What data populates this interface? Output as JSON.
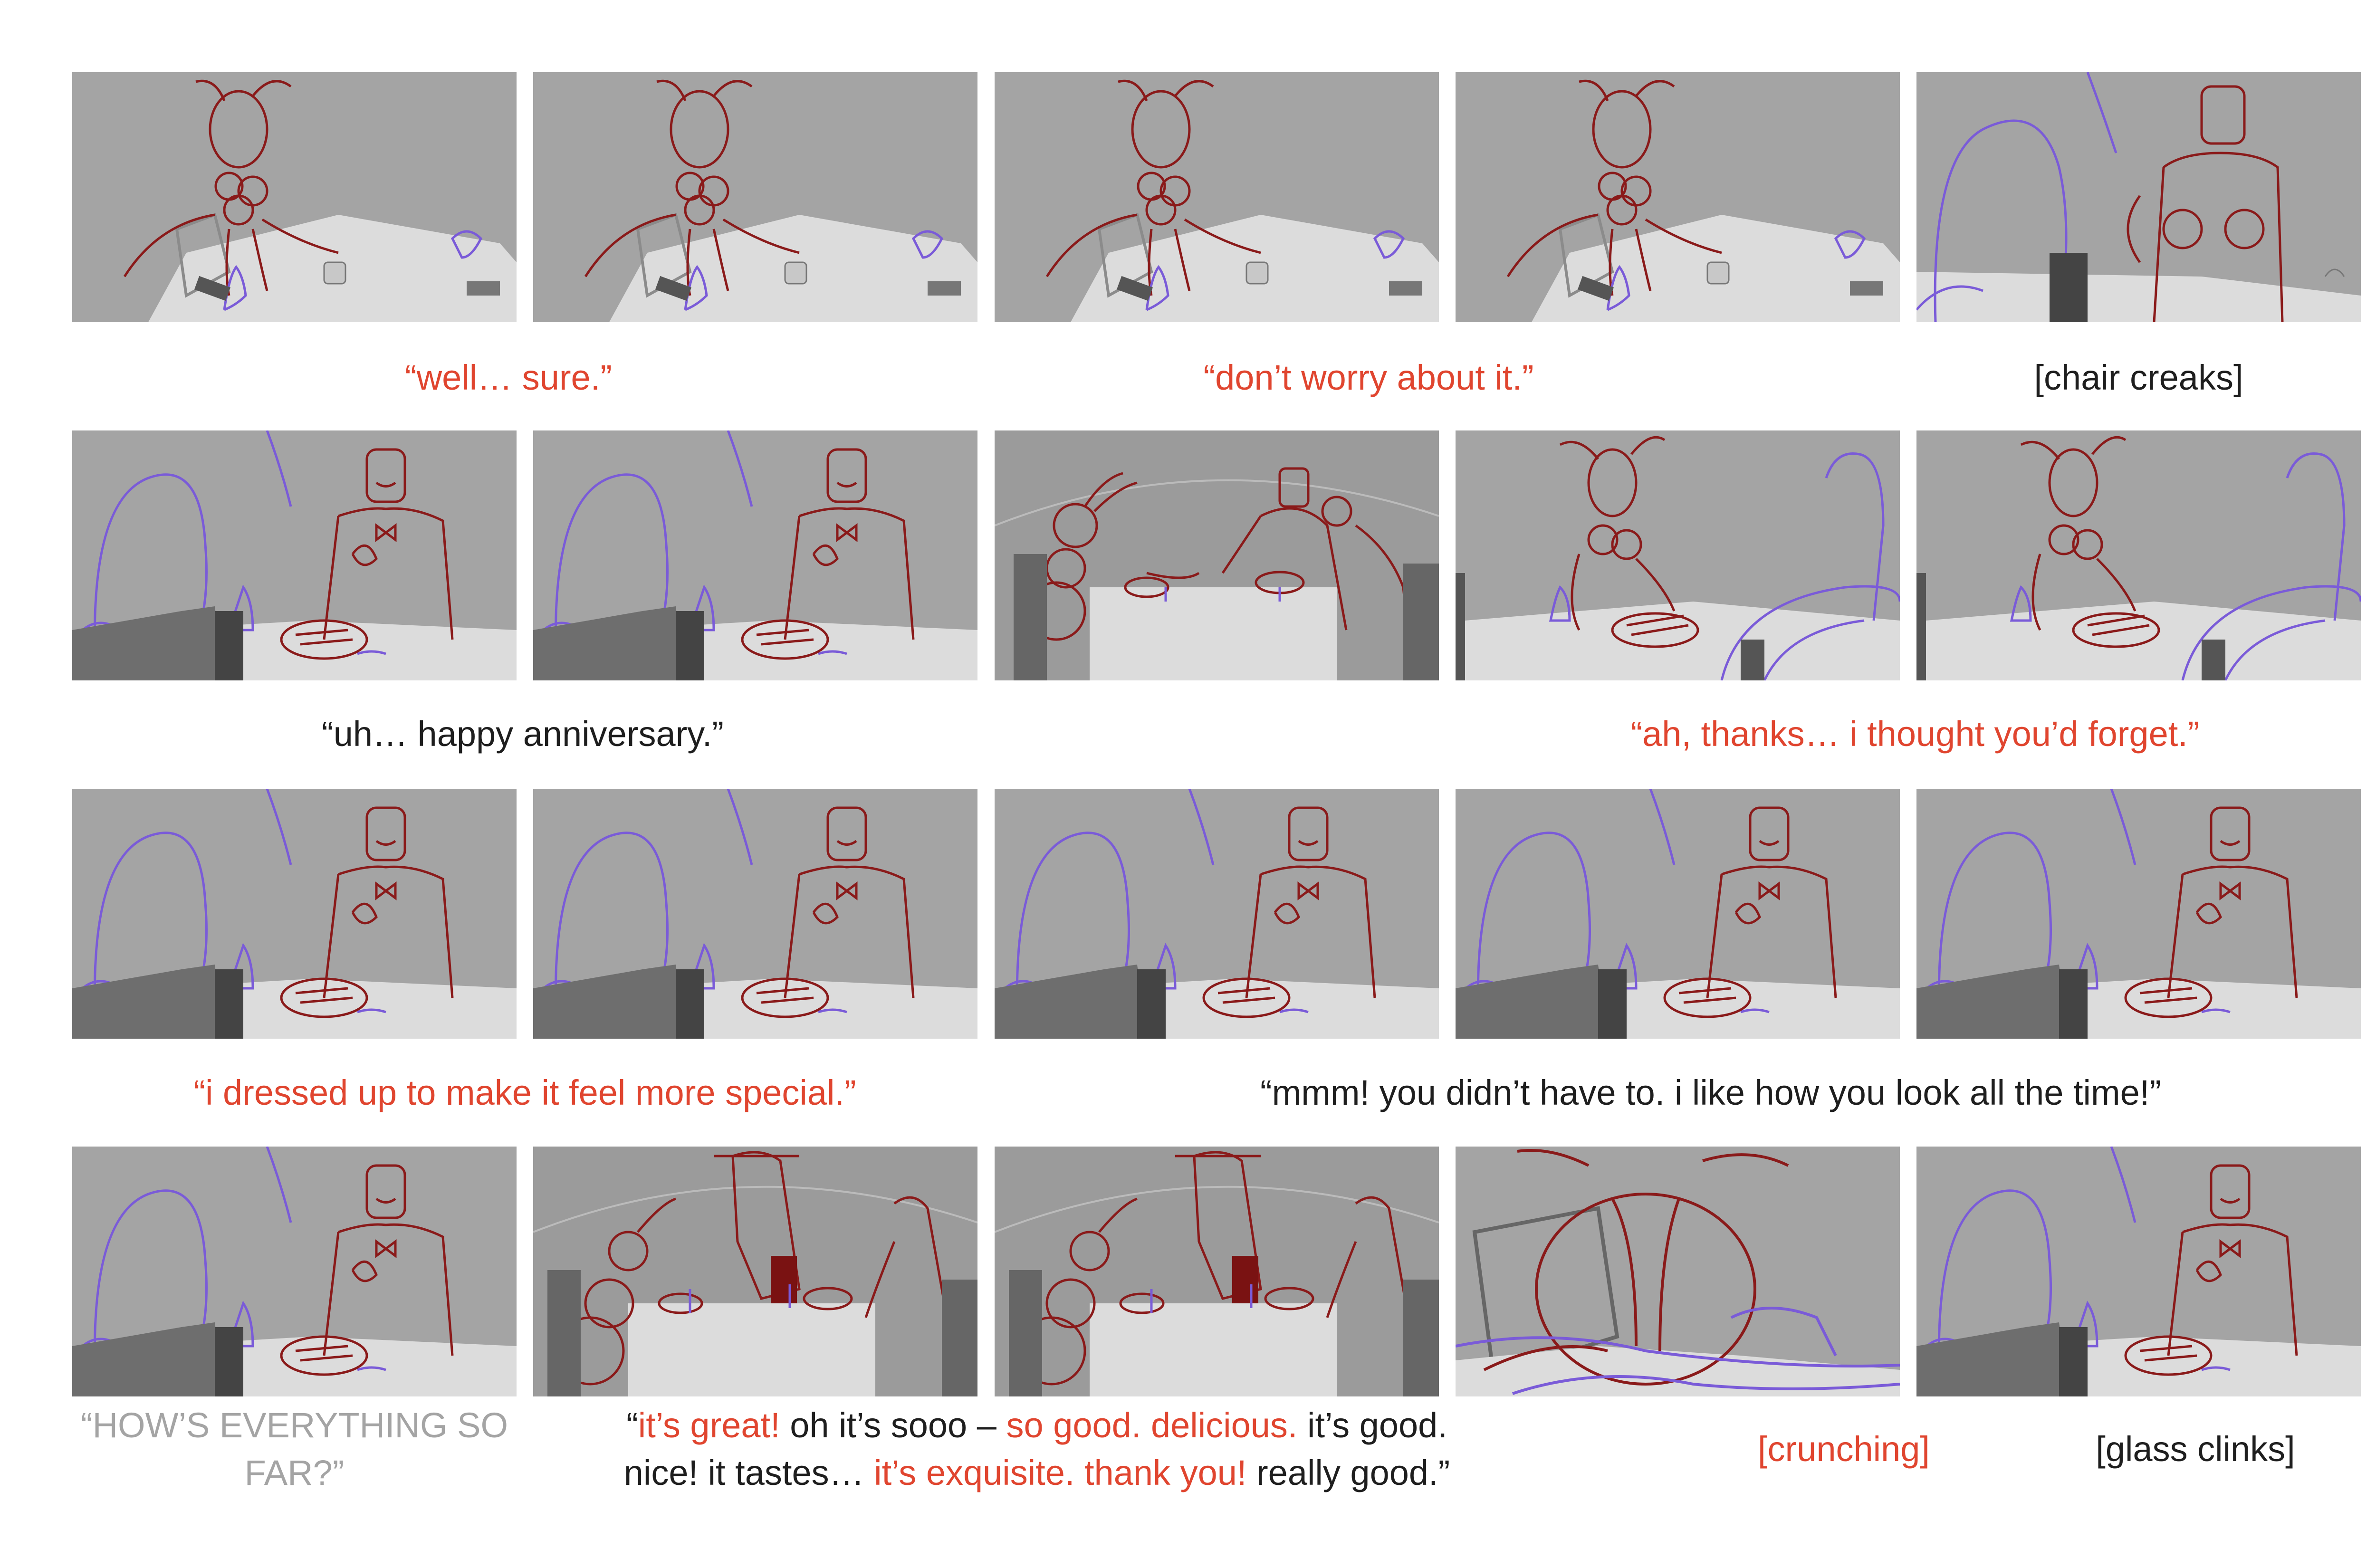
{
  "colors": {
    "panel_bg": "#a4a4a4",
    "table": "#dcdcdc",
    "sketch_red": "#8a1a1a",
    "sketch_purple": "#7a5bd8",
    "caption_red": "#e0452f",
    "caption_black": "#1e1e1e",
    "caption_gray": "#a4a4a4"
  },
  "rows": [
    {
      "panels": [
        {
          "shot": "ant-wide"
        },
        {
          "shot": "ant-wide"
        },
        {
          "shot": "ant-wide"
        },
        {
          "shot": "ant-wide"
        },
        {
          "shot": "man-closeup"
        }
      ],
      "captions": [
        {
          "text": "“well… sure.”",
          "style": "red"
        },
        {
          "text": "“don’t worry about it.”",
          "style": "red"
        },
        {
          "text": "[chair creaks]",
          "style": "black"
        }
      ]
    },
    {
      "panels": [
        {
          "shot": "man-ots"
        },
        {
          "shot": "man-ots"
        },
        {
          "shot": "wide-two"
        },
        {
          "shot": "ant-ots"
        },
        {
          "shot": "ant-ots"
        }
      ],
      "captions": [
        {
          "text": "“uh… happy anniversary.”",
          "style": "black"
        },
        {
          "text": "“ah, thanks… i thought you’d forget.”",
          "style": "red"
        }
      ]
    },
    {
      "panels": [
        {
          "shot": "man-ots"
        },
        {
          "shot": "man-ots"
        },
        {
          "shot": "man-ots"
        },
        {
          "shot": "man-ots"
        },
        {
          "shot": "man-ots"
        }
      ],
      "captions": [
        {
          "text": "“i dressed up to make it feel more special.”",
          "style": "red"
        },
        {
          "text": "“mmm! you didn’t have to. i like how you look all the time!”",
          "style": "black"
        }
      ]
    },
    {
      "panels": [
        {
          "shot": "man-ots"
        },
        {
          "shot": "wide-waiter"
        },
        {
          "shot": "wide-waiter"
        },
        {
          "shot": "ant-extreme-closeup"
        },
        {
          "shot": "man-ots"
        }
      ],
      "captions": [
        {
          "text": "“HOW’S EVERYTHING SO FAR?”",
          "line1": "“HOW’S EVERYTHING SO",
          "line2": "FAR?”",
          "style": "gray"
        },
        {
          "line1_parts": [
            {
              "text": "“",
              "style": "black"
            },
            {
              "text": "it’s great!",
              "style": "red"
            },
            {
              "text": " oh it’s sooo – ",
              "style": "black"
            },
            {
              "text": "so good. delicious.",
              "style": "red"
            },
            {
              "text": " it’s good.",
              "style": "black"
            }
          ],
          "line2_parts": [
            {
              "text": "nice! it tastes… ",
              "style": "black"
            },
            {
              "text": "it’s exquisite. thank you!",
              "style": "red"
            },
            {
              "text": " really good.”",
              "style": "black"
            }
          ]
        },
        {
          "text": "[crunching]",
          "style": "red"
        },
        {
          "text": "[glass clinks]",
          "style": "black"
        }
      ]
    }
  ]
}
